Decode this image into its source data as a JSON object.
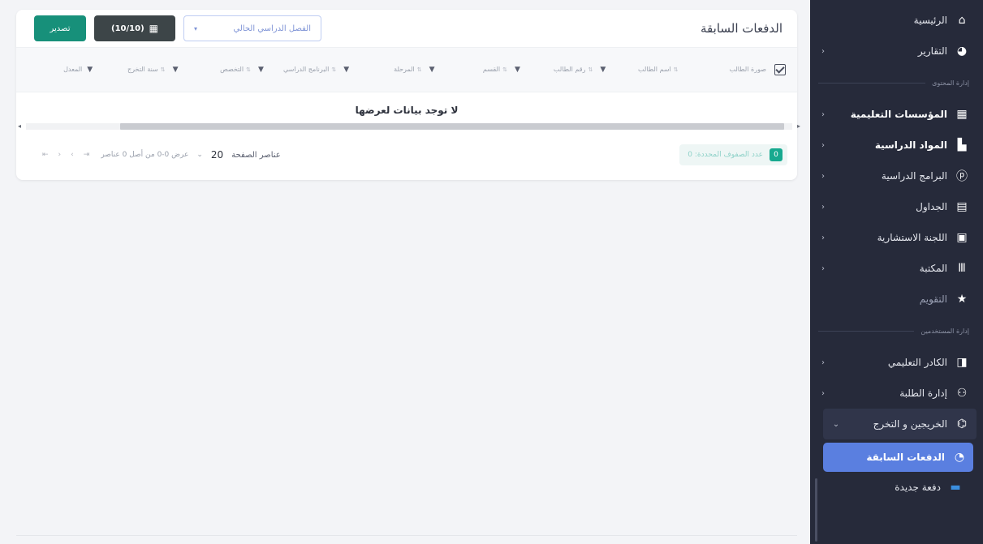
{
  "sidebar": {
    "items": [
      {
        "label": "الرئيسية",
        "icon": "home-icon"
      },
      {
        "label": "التقارير",
        "icon": "pie-chart-icon"
      }
    ],
    "section_1": "إدارة المحتوى",
    "section_1_items": [
      {
        "label": "المؤسسات التعليمية",
        "icon": "building-icon"
      },
      {
        "label": "المواد الدراسية",
        "icon": "book-icon"
      },
      {
        "label": "البرامج الدراسية",
        "icon": "program-icon"
      },
      {
        "label": "الجداول",
        "icon": "table-icon"
      },
      {
        "label": "اللجنة الاستشارية",
        "icon": "grid-icon"
      },
      {
        "label": "المكتبة",
        "icon": "library-icon"
      },
      {
        "label": "التقويم",
        "icon": "star-icon"
      }
    ],
    "section_2": "إدارة المستخدمين",
    "section_2_items": [
      {
        "label": "الكادر التعليمي",
        "icon": "door-icon"
      },
      {
        "label": "إدارة الطلبة",
        "icon": "users-icon"
      },
      {
        "label": "الخريجين و التخرج",
        "icon": "graduation-cap-icon"
      }
    ],
    "sub_items": [
      {
        "label": "الدفعات السابقة",
        "icon": "history-icon"
      },
      {
        "label": "دفعة جديدة",
        "icon": "add-batch-icon"
      }
    ]
  },
  "main": {
    "title": "الدفعات السابقة",
    "filter_placeholder": "الفصل الدراسي الحالي",
    "columns_button": "(10/10)",
    "export_button": "تصدير",
    "columns": [
      {
        "label": "صورة الطالب"
      },
      {
        "label": "اسم الطالب"
      },
      {
        "label": "رقم الطالب"
      },
      {
        "label": "القسم"
      },
      {
        "label": "المرحلة"
      },
      {
        "label": "البرنامج الدراسي"
      },
      {
        "label": "التخصص"
      },
      {
        "label": "سنة التخرج"
      },
      {
        "label": "المعدل"
      }
    ],
    "empty_text": "لا توجد بيانات لعرضها",
    "footer": {
      "chip_text": "عدد الصفوف المحددة: 0",
      "chip_count": "0",
      "per_page_label": "عناصر الصفحة",
      "per_page_value": "20",
      "range_text": "عرض 0-0 من أصل 0 عناصر"
    }
  }
}
